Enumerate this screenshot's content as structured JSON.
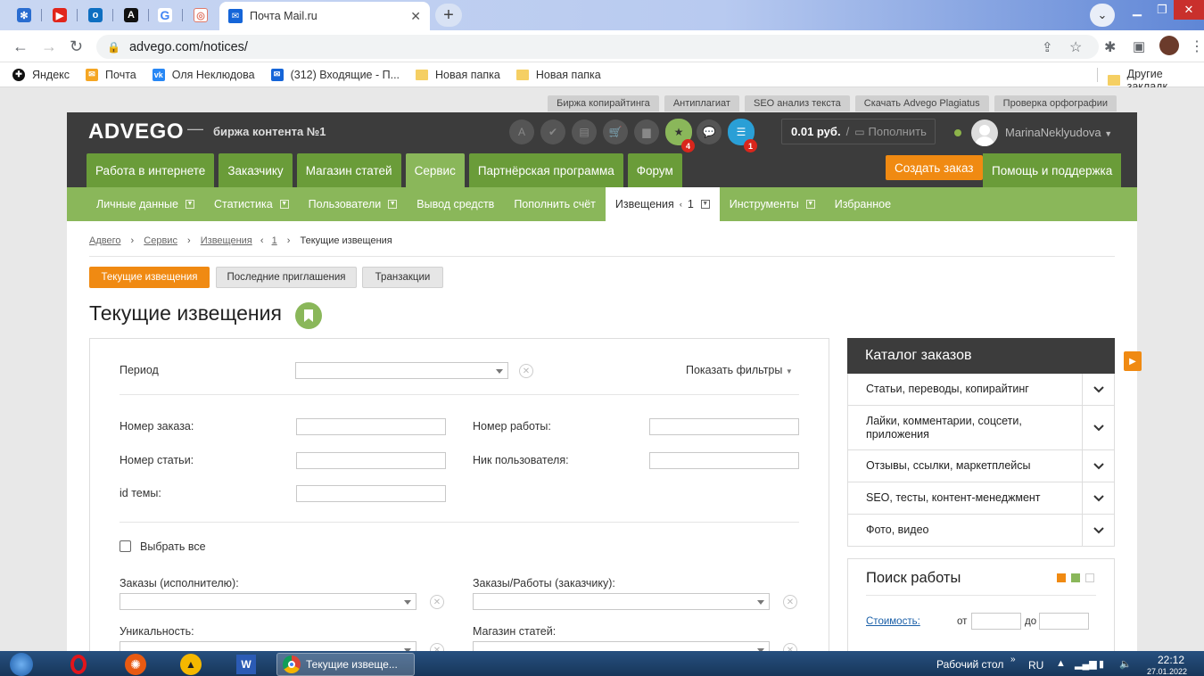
{
  "browser": {
    "active_tab_title": "Почта Mail.ru",
    "url": "advego.com/notices/",
    "new_tab": "+",
    "bookmarks": [
      "Яндекс",
      "Почта",
      "Оля Неклюдова",
      "(312) Входящие - П...",
      "Новая папка",
      "Новая папка"
    ],
    "other_bookmarks": "Другие закладк"
  },
  "site": {
    "top_links": [
      "Биржа копирайтинга",
      "Антиплагиат",
      "SEO анализ текста",
      "Скачать Advego Plagiatus",
      "Проверка орфографии"
    ],
    "logo": "ADVEGO",
    "dash": "—",
    "tagline": "биржа контента №1",
    "badge_star": "4",
    "badge_list": "1",
    "balance_amount": "0.01 руб.",
    "balance_slash": "/",
    "topup_label": "Пополнить",
    "username": "MarinaNeklyudova",
    "main_nav": [
      "Работа в интернете",
      "Заказчику",
      "Магазин статей",
      "Сервис",
      "Партнёрская программа",
      "Форум"
    ],
    "create_order": "Создать заказ",
    "help": "Помощь и поддержка",
    "sub_nav": {
      "personal": "Личные данные",
      "stats": "Статистика",
      "users": "Пользователи",
      "withdraw": "Вывод средств",
      "deposit": "Пополнить счёт",
      "notices": "Извещения",
      "notices_count": "1",
      "tools": "Инструменты",
      "favorites": "Избранное"
    }
  },
  "breadcrumb": {
    "home": "Адвего",
    "service": "Сервис",
    "notices": "Извещения",
    "count": "1",
    "current": "Текущие извещения"
  },
  "tabs": [
    "Текущие извещения",
    "Последние приглашения",
    "Транзакции"
  ],
  "page_title": "Текущие извещения",
  "filters": {
    "period_label": "Период",
    "show_filters": "Показать фильтры",
    "order_number": "Номер заказа:",
    "work_number": "Номер работы:",
    "article_number": "Номер статьи:",
    "user_nick": "Ник пользователя:",
    "topic_id": "id темы:",
    "select_all": "Выбрать все",
    "orders_executor": "Заказы (исполнителю):",
    "orders_customer": "Заказы/Работы (заказчику):",
    "uniqueness": "Уникальность:",
    "article_shop": "Магазин статей:"
  },
  "catalog": {
    "title": "Каталог заказов",
    "items": [
      "Статьи, переводы, копирайтинг",
      "Лайки, комментарии, соцсети, приложения",
      "Отзывы, ссылки, маркетплейсы",
      "SEO, тесты, контент-менеджмент",
      "Фото, видео"
    ]
  },
  "search_work": {
    "title": "Поиск работы",
    "cost_label": "Стоимость:",
    "from": "от",
    "to": "до"
  },
  "taskbar": {
    "chrome_label": "Текущие извеще...",
    "desktop": "Рабочий стол",
    "lang": "RU",
    "time": "22:12",
    "date": "27.01.2022"
  },
  "colors": {
    "green_dark": "#6a9c39",
    "green_light": "#8ab75a",
    "orange": "#f08a12",
    "header": "#3c3c3c"
  }
}
